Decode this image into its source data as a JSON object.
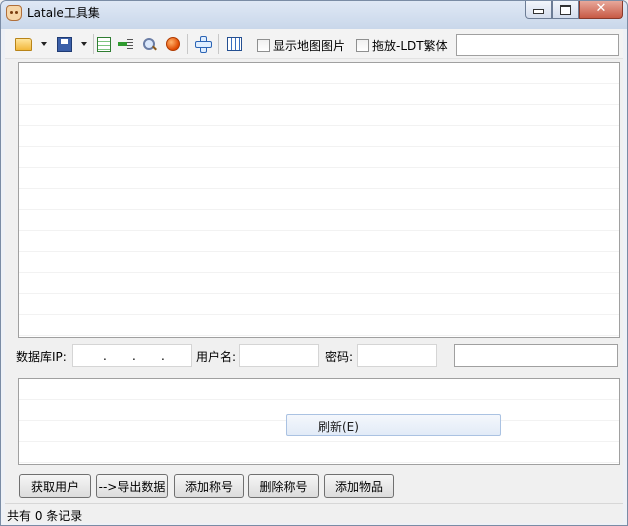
{
  "window": {
    "title": "Latale工具集",
    "close_glyph": "✕"
  },
  "toolbar": {
    "icons": [
      "folder-open-icon",
      "save-icon",
      "export-excel-icon",
      "add-row-icon",
      "search-icon",
      "record-icon",
      "cross-icon",
      "grid-icon"
    ],
    "show_map_image_label": "显示地图图片",
    "drag_ldt_traditional_label": "拖放-LDT繁体",
    "search_value": ""
  },
  "connection": {
    "db_ip_label": "数据库IP:",
    "ip_parts": [
      ".",
      ".",
      "."
    ],
    "username_label": "用户名:",
    "username_value": "",
    "password_label": "密码:",
    "password_value": "",
    "extra_value": ""
  },
  "context_menu": {
    "refresh_label": "刷新(E)"
  },
  "buttons": {
    "get_users": "获取用户",
    "export_data": "-->导出数据",
    "add_title": "添加称号",
    "delete_title": "删除称号",
    "add_item": "添加物品"
  },
  "status": {
    "record_count_text": "共有 0 条记录"
  }
}
